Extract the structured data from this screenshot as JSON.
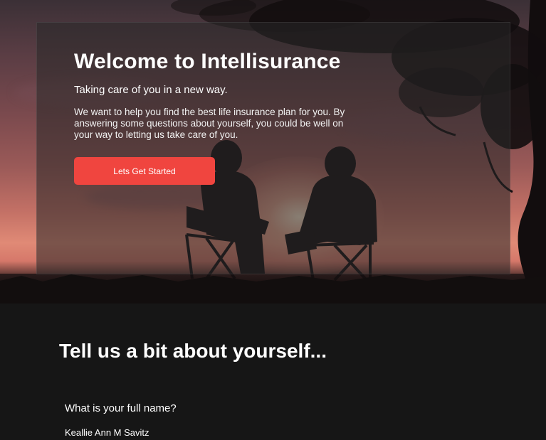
{
  "hero": {
    "title": "Welcome to Intellisurance",
    "subtitle": "Taking care of you in a new way.",
    "body": "We want to help you find the best life insurance plan for you. By answering some questions about yourself, you could be well on your way to letting us take care of you.",
    "cta_label": "Lets Get Started",
    "background_image": "sunset-couple-silhouette",
    "accent_color": "#f0453f"
  },
  "about": {
    "heading": "Tell us a bit about yourself...",
    "questions": [
      {
        "label": "What is your full name?",
        "value": "Keallie Ann M Savitz"
      }
    ]
  }
}
